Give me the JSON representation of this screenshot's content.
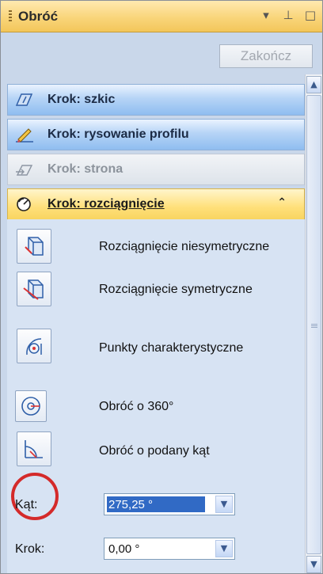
{
  "window": {
    "title": "Obróć",
    "controls": [
      "▾",
      "⊥",
      "□"
    ]
  },
  "finish_button": "Zakończ",
  "steps": [
    {
      "label": "Krok: szkic",
      "state": "active"
    },
    {
      "label": "Krok: rysowanie profilu",
      "state": "active"
    },
    {
      "label": "Krok: strona",
      "state": "disabled"
    },
    {
      "label": "Krok: rozciągnięcie",
      "state": "expanded",
      "chevron": "⌃"
    }
  ],
  "tools": [
    {
      "label": "Rozciągnięcie niesymetryczne",
      "icon": "asymmetric-extrude-icon"
    },
    {
      "label": "Rozciągnięcie symetryczne",
      "icon": "symmetric-extrude-icon"
    },
    {
      "label": "Punkty charakterystyczne",
      "icon": "key-points-icon"
    },
    {
      "label": "Obróć o 360°",
      "icon": "rotate-360-icon",
      "highlighted": true
    },
    {
      "label": "Obróć o podany kąt",
      "icon": "rotate-angle-icon"
    }
  ],
  "fields": {
    "angle": {
      "label": "Kąt:",
      "value": "275,25 °"
    },
    "step": {
      "label": "Krok:",
      "value": "0,00 °"
    }
  },
  "scrollbar": {
    "up": "▲",
    "down": "▼"
  },
  "colors": {
    "accent": "#f9d57a",
    "highlight_ring": "#d42a2a",
    "selection": "#316ac5"
  }
}
